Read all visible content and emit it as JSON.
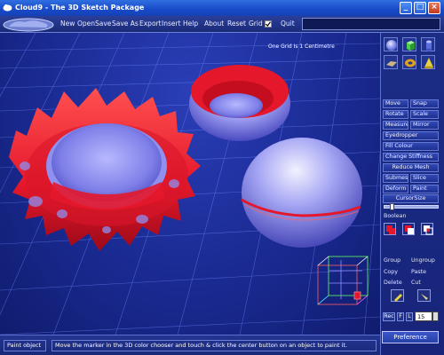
{
  "window": {
    "title": "Cloud9 - The 3D Sketch Package",
    "minimize_glyph": "_",
    "maximize_glyph": "□",
    "close_glyph": "×"
  },
  "logo": {
    "text": "Cloud9",
    "icon": "cloud9-logo"
  },
  "menu": {
    "items": [
      "New",
      "Open",
      "Save",
      "Save As",
      "Export",
      "Insert",
      "Help",
      "About",
      "Reset",
      "Grid",
      "Quit"
    ],
    "grid_checked": true
  },
  "viewport": {
    "grid_label": "One Grid Is 1 Centimetre"
  },
  "tools": {
    "primitives": [
      "sphere-icon",
      "cube-icon",
      "cylinder-icon",
      "plane-icon",
      "torus-icon",
      "cone-icon"
    ],
    "move": "Move",
    "snap": "Snap",
    "rotate": "Rotate",
    "scale": "Scale",
    "measure": "Measure",
    "mirror": "Mirror",
    "eyedropper": "Eyedropper",
    "fill_colour": "Fill Colour",
    "change_stiffness": "Change Stiffness",
    "reduce_mesh": "Reduce Mesh",
    "submesh": "Submesh",
    "slice": "Slice",
    "deform": "Deform",
    "paint": "Paint",
    "cursor_size": "CursorSize",
    "boolean": "Boolean",
    "group": "Group",
    "ungroup": "Ungroup",
    "copy": "Copy",
    "paste": "Paste",
    "delete": "Delete",
    "cut": "Cut",
    "rec": "Rec",
    "f": "F",
    "l": "L",
    "number_value": "15",
    "preference": "Preference"
  },
  "status": {
    "mode": "Paint object",
    "message": "Move the marker in the 3D color chooser and touch & click the center button on an object to paint it."
  },
  "colors": {
    "background": "#1a2a92",
    "paint": "#e4172b",
    "object": "#9a9af0",
    "panel": "#1c2d86"
  }
}
